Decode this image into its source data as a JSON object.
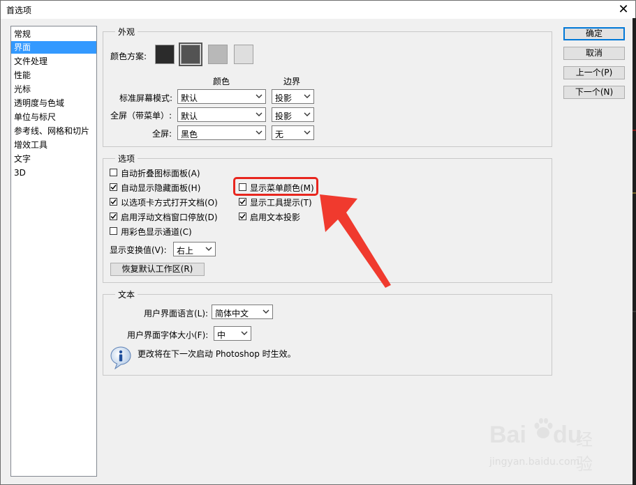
{
  "window": {
    "title": "首选项",
    "close_glyph": "✕"
  },
  "sidebar": {
    "items": [
      {
        "label": "常规"
      },
      {
        "label": "界面",
        "selected": true
      },
      {
        "label": "文件处理"
      },
      {
        "label": "性能"
      },
      {
        "label": "光标"
      },
      {
        "label": "透明度与色域"
      },
      {
        "label": "单位与标尺"
      },
      {
        "label": "参考线、网格和切片"
      },
      {
        "label": "增效工具"
      },
      {
        "label": "文字"
      },
      {
        "label": "3D"
      }
    ]
  },
  "buttons": {
    "ok": "确定",
    "cancel": "取消",
    "prev": "上一个(P)",
    "next": "下一个(N)"
  },
  "appearance": {
    "group_label": "外观",
    "color_scheme_label": "颜色方案:",
    "swatches": [
      "#2b2b2b",
      "#535353",
      "#b8b8b8",
      "#dedede"
    ],
    "selected_swatch": 1,
    "col_color": "颜色",
    "col_border": "边界",
    "rows": [
      {
        "label": "标准屏幕模式:",
        "color": "默认",
        "border": "投影"
      },
      {
        "label": "全屏（带菜单）:",
        "color": "默认",
        "border": "投影"
      },
      {
        "label": "全屏:",
        "color": "黑色",
        "border": "无"
      }
    ]
  },
  "options": {
    "group_label": "选项",
    "checkboxes": [
      {
        "label": "自动折叠图标面板(A)",
        "checked": false
      },
      {
        "label": "自动显示隐藏面板(H)",
        "checked": true
      },
      {
        "label": "以选项卡方式打开文档(O)",
        "checked": true
      },
      {
        "label": "启用浮动文档窗口停放(D)",
        "checked": true
      },
      {
        "label": "用彩色显示通道(C)",
        "checked": false
      },
      {
        "label": "显示菜单颜色(M)",
        "checked": false
      },
      {
        "label": "显示工具提示(T)",
        "checked": true
      },
      {
        "label": "启用文本投影",
        "checked": true
      }
    ],
    "transform_label": "显示变换值(V):",
    "transform_value": "右上",
    "restore_button": "恢复默认工作区(R)"
  },
  "text_group": {
    "group_label": "文本",
    "ui_language_label": "用户界面语言(L):",
    "ui_language_value": "简体中文",
    "ui_font_size_label": "用户界面字体大小(F):",
    "ui_font_size_value": "中",
    "info_message": "更改将在下一次启动 Photoshop 时生效。"
  },
  "watermark": {
    "brand": "Bai",
    "brand2": "du",
    "brand_cn": "经验",
    "url": "jingyan.baidu.com"
  },
  "colors": {
    "accent": "#3399ff",
    "highlight": "#e8261e",
    "arrow": "#f03a2e"
  }
}
